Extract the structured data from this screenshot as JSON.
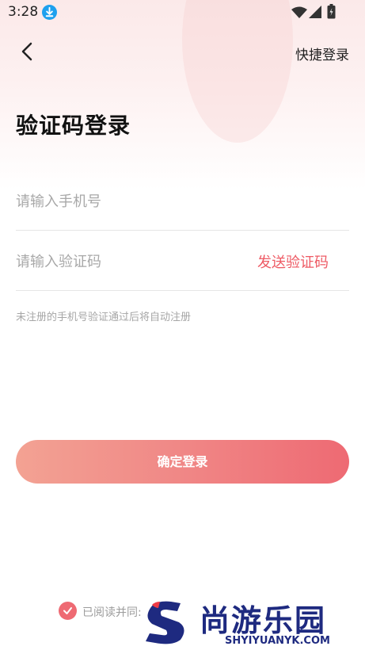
{
  "status_bar": {
    "time": "3:28",
    "icons": [
      "download-icon",
      "wifi-icon",
      "signal-icon",
      "battery-icon"
    ]
  },
  "header": {
    "back_icon": "chevron-left-icon",
    "quick_login_label": "快捷登录"
  },
  "title": "验证码登录",
  "form": {
    "phone_placeholder": "请输入手机号",
    "phone_value": "",
    "code_placeholder": "请输入验证码",
    "code_value": "",
    "send_code_label": "发送验证码",
    "hint": "未注册的手机号验证通过后将自动注册"
  },
  "login_button_label": "确定登录",
  "agreement": {
    "checked": true,
    "text": "已阅读并同:"
  },
  "watermark": {
    "name": "尚游乐园",
    "url": "SHYIYUANYK.COM"
  },
  "colors": {
    "accent": "#ee5a64",
    "button_gradient_start": "#f3a293",
    "button_gradient_end": "#ee6a73",
    "watermark": "#1e2a80"
  }
}
